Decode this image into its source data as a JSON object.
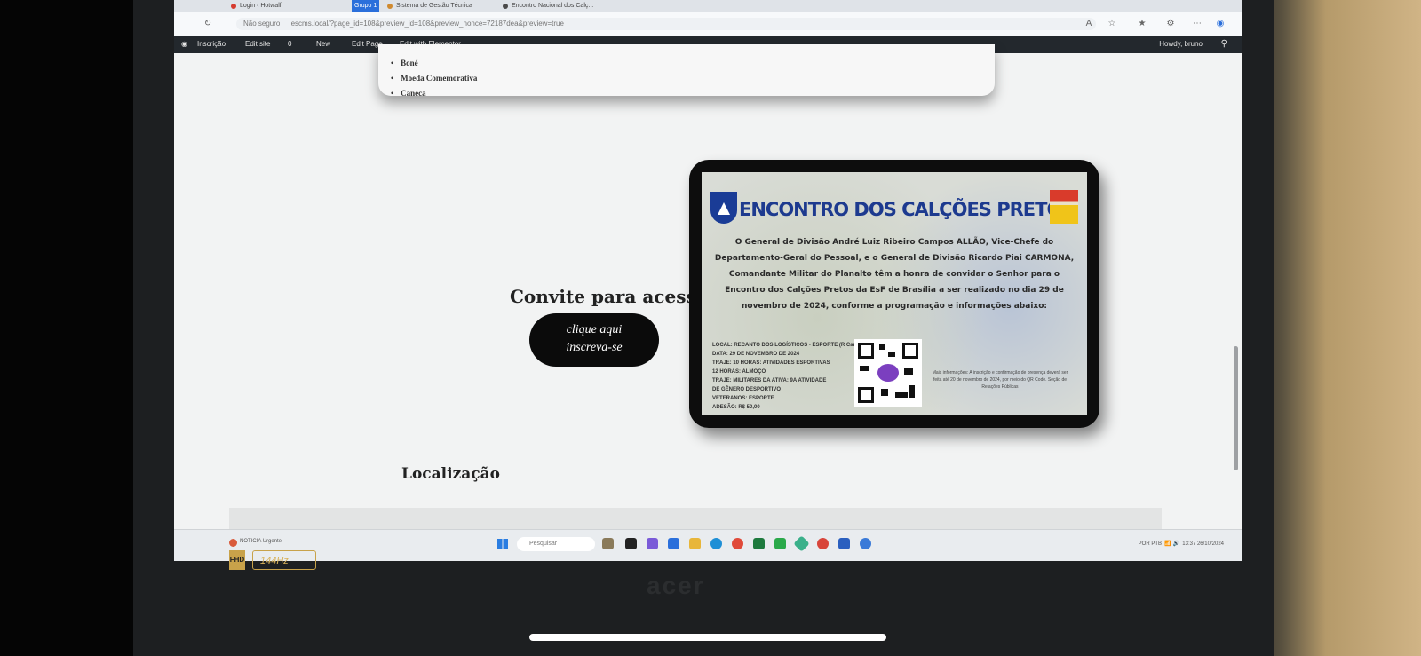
{
  "browser": {
    "tabs": [
      {
        "label": "Login ‹ Hotwalf"
      },
      {
        "label": "Grupo 1"
      },
      {
        "label": "Sistema de Gestão Técnica"
      },
      {
        "label": "Encontro Nacional dos Calç..."
      }
    ],
    "security_label": "Não seguro",
    "url": "escms.local/?page_id=108&preview_id=108&preview_nonce=72187dea&preview=true"
  },
  "wp_admin_bar": {
    "items": [
      "Inscrição",
      "Edit site",
      "0",
      "New",
      "Edit Page",
      "Edit with Elementor"
    ],
    "howdy": "Howdy, bruno"
  },
  "page": {
    "list_items": [
      "Boné",
      "Moeda Comemorativa",
      "Caneca"
    ],
    "invite_title": "Convite para acesso",
    "cta_line1": "clique aqui",
    "cta_line2": "inscreva-se",
    "location_title": "Localização"
  },
  "invite_card": {
    "title": "ENCONTRO DOS CALÇÕES PRETOS",
    "body": "O General de Divisão André Luiz Ribeiro Campos ALLÃO, Vice-Chefe do Departamento-Geral do Pessoal, e o General de Divisão Ricardo Piai CARMONA, Comandante Militar do Planalto têm a honra de convidar o Senhor para o Encontro dos Calções Pretos da EsF de Brasília a ser realizado no dia 29 de novembro de 2024, conforme a programação e informações abaixo:",
    "details": [
      "LOCAL: RECANTO DOS LOGÍSTICOS - ESPORTE (R Carl",
      "DATA: 29 DE NOVEMBRO DE 2024",
      "TRAJE: 10 HORAS: ATIVIDADES ESPORTIVAS",
      "12 HORAS: ALMOÇO",
      "TRAJE: MILITARES DA ATIVA: 9A ATIVIDADE",
      "DE GÊNERO DESPORTIVO",
      "VETERANOS: ESPORTE",
      "ADESÃO: R$ 50,00"
    ],
    "side_note": "Mais informações: A inscrição e confirmação de presença deverá ser feita até 20 de novembro de 2024, por meio do QR Code. Seção de Relações Públicas"
  },
  "taskbar": {
    "weather": "NOTICIA Urgente",
    "search_placeholder": "Pesquisar",
    "tray_lang": "POR PTB",
    "tray_time": "13:37",
    "tray_date": "26/10/2024"
  },
  "laptop": {
    "sticker": "FHD",
    "refresh_label": "144Hz",
    "brand": "acer"
  }
}
